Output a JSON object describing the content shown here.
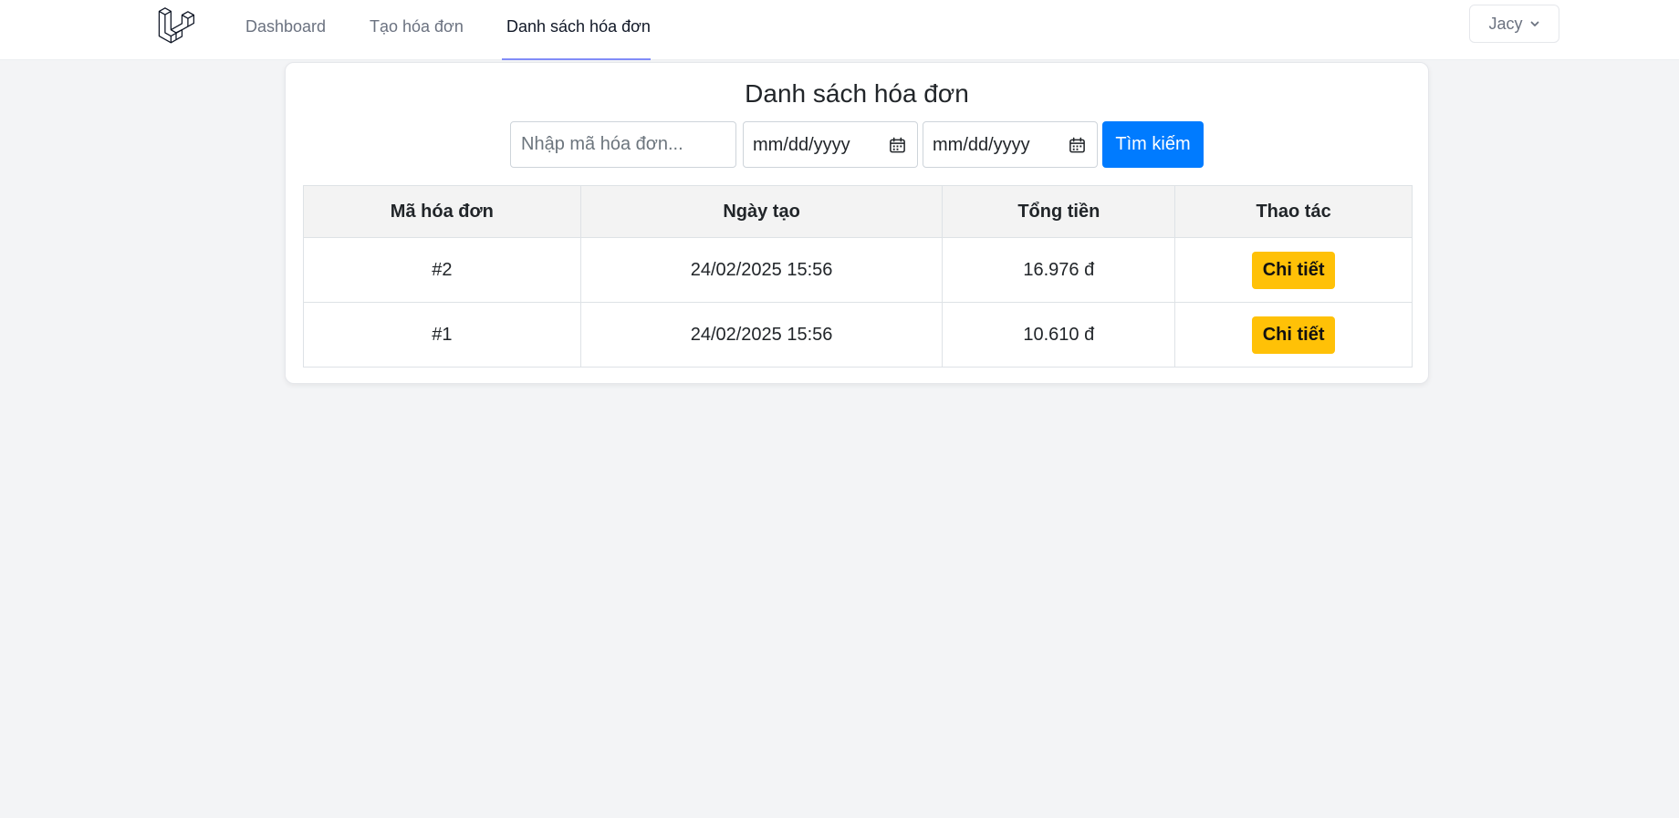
{
  "nav": {
    "logo_icon": "laravel-logo-icon",
    "links": [
      {
        "label": "Dashboard",
        "active": false
      },
      {
        "label": "Tạo hóa đơn",
        "active": false
      },
      {
        "label": "Danh sách hóa đơn",
        "active": true
      }
    ],
    "user": {
      "name": "Jacy",
      "icon": "chevron-down-icon"
    }
  },
  "page": {
    "title": "Danh sách hóa đơn",
    "filters": {
      "search_placeholder": "Nhập mã hóa đơn...",
      "search_value": "",
      "date_from": "mm/dd/yyyy",
      "date_to": "mm/dd/yyyy",
      "date_icon": "calendar-icon",
      "submit_label": "Tìm kiếm"
    },
    "table": {
      "headers": [
        "Mã hóa đơn",
        "Ngày tạo",
        "Tổng tiền",
        "Thao tác"
      ],
      "rows": [
        {
          "id": "#2",
          "created": "24/02/2025 15:56",
          "total": "16.976 đ",
          "action": "Chi tiết"
        },
        {
          "id": "#1",
          "created": "24/02/2025 15:56",
          "total": "10.610 đ",
          "action": "Chi tiết"
        }
      ]
    }
  },
  "colors": {
    "primary": "#007bff",
    "warning": "#ffc107",
    "nav_active_underline": "#818cf8",
    "background": "#f3f4f6"
  }
}
